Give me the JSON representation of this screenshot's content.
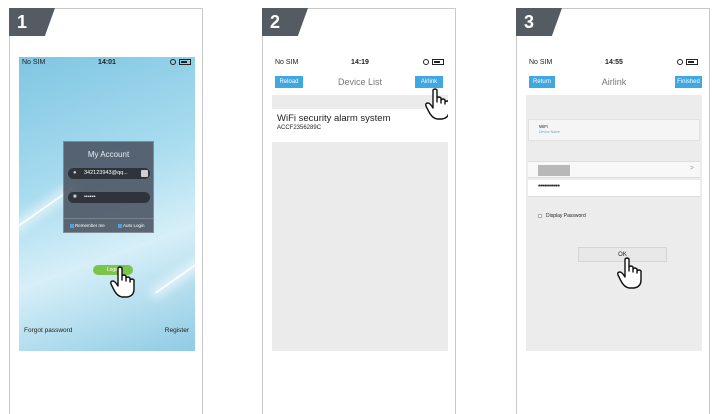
{
  "steps": [
    "1",
    "2",
    "3"
  ],
  "login": {
    "status": {
      "carrier": "No SIM",
      "time": "14:01"
    },
    "card_title": "My Account",
    "account_value": "342123943@qq...",
    "password_value": "••••••",
    "remember_label": "Remember me",
    "autologin_label": "Auto Login",
    "login_button": "Login",
    "forgot_password": "Forgot password",
    "register": "Register"
  },
  "device_list": {
    "status": {
      "carrier": "No SIM",
      "time": "14:19"
    },
    "reload_button": "Reload",
    "title": "Device List",
    "airlink_button": "Airlink",
    "devices": [
      {
        "name": "WiFi security alarm system",
        "id": "ACCF2356289C"
      }
    ]
  },
  "airlink": {
    "status": {
      "carrier": "No SIM",
      "time": "14:55"
    },
    "return_button": "Return",
    "title": "Airlink",
    "finished_button": "Finished",
    "wifi_label": "WiFi",
    "wifi_sublabel": "Device Name",
    "ssid_chevron": ">",
    "password_value": "•••••••••••",
    "display_password_label": "Display Password",
    "ok_button": "OK"
  },
  "colors": {
    "step_tab": "#555b63",
    "accent_blue": "#3fa7e2",
    "login_green": "#7cc44a"
  }
}
